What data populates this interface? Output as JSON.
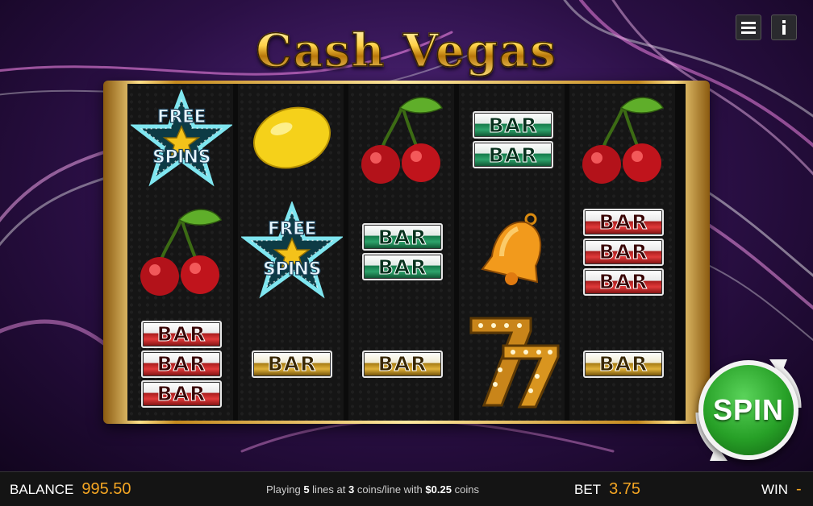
{
  "game": {
    "title": "Cash Vegas"
  },
  "toolbar": {
    "menu_icon": "hamburger-menu-icon",
    "info_icon": "info-icon"
  },
  "reels": [
    [
      "free-spins",
      "cherry",
      "bar-red-3"
    ],
    [
      "lemon",
      "free-spins",
      "bar-gold-1"
    ],
    [
      "cherry",
      "bar-green-2",
      "bar-gold-1"
    ],
    [
      "bar-green-2",
      "bell",
      "seven"
    ],
    [
      "cherry",
      "bar-red-3",
      "bar-gold-1"
    ]
  ],
  "symbols": {
    "bar_text": "BAR",
    "free_spins_line1": "FREE",
    "free_spins_line2": "SPINS"
  },
  "spin": {
    "label": "SPIN"
  },
  "footer": {
    "balance_label": "BALANCE",
    "balance_value": "995.50",
    "playing_prefix": "Playing",
    "lines": "5",
    "lines_text": "lines at",
    "coins": "3",
    "coins_text": "coins/line with",
    "coin_value": "$0.25",
    "coin_suffix": "coins",
    "bet_label": "BET",
    "bet_value": "3.75",
    "win_label": "WIN",
    "win_value": "-"
  },
  "colors": {
    "accent": "#f5a623",
    "spin_green": "#27a027",
    "frame_gold": "#ffe089"
  }
}
